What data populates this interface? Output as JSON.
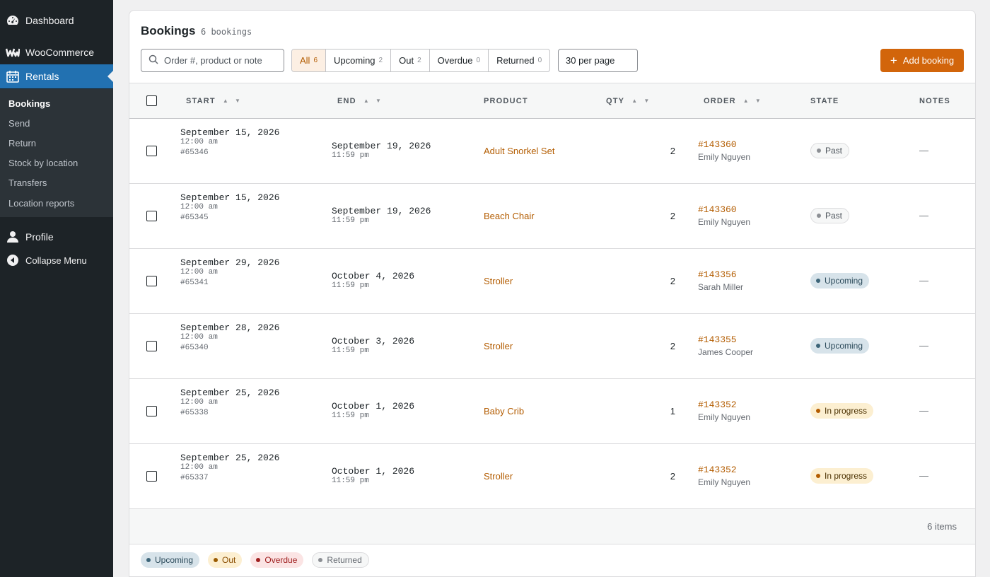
{
  "sidebar": {
    "dashboard": "Dashboard",
    "woocommerce": "WooCommerce",
    "rentals": "Rentals",
    "submenu": [
      "Bookings",
      "Send",
      "Return",
      "Stock by location",
      "Transfers",
      "Location reports"
    ],
    "profile": "Profile",
    "collapse": "Collapse Menu"
  },
  "page": {
    "title": "Bookings",
    "count": "6 bookings",
    "search_placeholder": "Order #, product or note",
    "filters": [
      {
        "label": "All",
        "count": "6"
      },
      {
        "label": "Upcoming",
        "count": "2"
      },
      {
        "label": "Out",
        "count": "2"
      },
      {
        "label": "Overdue",
        "count": "0"
      },
      {
        "label": "Returned",
        "count": "0"
      }
    ],
    "per_page": "30 per page",
    "add_button": "Add booking"
  },
  "table": {
    "headers": {
      "start": "START",
      "end": "END",
      "product": "PRODUCT",
      "qty": "QTY",
      "order": "ORDER",
      "state": "STATE",
      "notes": "NOTES"
    },
    "rows": [
      {
        "start_date": "September 15, 2026",
        "start_time": "12:00 am",
        "booking_id": "#65346",
        "end_date": "September 19, 2026",
        "end_time": "11:59 pm",
        "product": "Adult Snorkel Set",
        "qty": "2",
        "order": "#143360",
        "customer": "Emily Nguyen",
        "state": "Past",
        "notes": "—"
      },
      {
        "start_date": "September 15, 2026",
        "start_time": "12:00 am",
        "booking_id": "#65345",
        "end_date": "September 19, 2026",
        "end_time": "11:59 pm",
        "product": "Beach Chair",
        "qty": "2",
        "order": "#143360",
        "customer": "Emily Nguyen",
        "state": "Past",
        "notes": "—"
      },
      {
        "start_date": "September 29, 2026",
        "start_time": "12:00 am",
        "booking_id": "#65341",
        "end_date": "October 4, 2026",
        "end_time": "11:59 pm",
        "product": "Stroller",
        "qty": "2",
        "order": "#143356",
        "customer": "Sarah Miller",
        "state": "Upcoming",
        "notes": "—"
      },
      {
        "start_date": "September 28, 2026",
        "start_time": "12:00 am",
        "booking_id": "#65340",
        "end_date": "October 3, 2026",
        "end_time": "11:59 pm",
        "product": "Stroller",
        "qty": "2",
        "order": "#143355",
        "customer": "James Cooper",
        "state": "Upcoming",
        "notes": "—"
      },
      {
        "start_date": "September 25, 2026",
        "start_time": "12:00 am",
        "booking_id": "#65338",
        "end_date": "October 1, 2026",
        "end_time": "11:59 pm",
        "product": "Baby Crib",
        "qty": "1",
        "order": "#143352",
        "customer": "Emily Nguyen",
        "state": "In progress",
        "notes": "—"
      },
      {
        "start_date": "September 25, 2026",
        "start_time": "12:00 am",
        "booking_id": "#65337",
        "end_date": "October 1, 2026",
        "end_time": "11:59 pm",
        "product": "Stroller",
        "qty": "2",
        "order": "#143352",
        "customer": "Emily Nguyen",
        "state": "In progress",
        "notes": "—"
      }
    ],
    "footer_items": "6 items"
  },
  "legend": [
    "Upcoming",
    "Out",
    "Overdue",
    "Returned"
  ],
  "colors": {
    "accent": "#d2650b",
    "link": "#b35c00",
    "sidebar_bg": "#1d2327",
    "sidebar_current": "#2271b1",
    "past_bg": "#f6f7f7",
    "past_dot": "#8c8f94",
    "past_text": "#50575e",
    "upcoming_bg": "#d7e3ea",
    "upcoming_dot": "#3c6478",
    "upcoming_text": "#2b4a5a",
    "inprogress_bg": "#fcefd1",
    "inprogress_dot": "#b35c00",
    "inprogress_text": "#4a3000",
    "out_bg": "#fcefd1",
    "out_dot": "#9a5b00",
    "out_text": "#8a4d00",
    "overdue_bg": "#fbe4e4",
    "overdue_dot": "#a02020",
    "overdue_text": "#a02020",
    "returned_bg": "#f6f7f7",
    "returned_dot": "#8c8f94",
    "returned_text": "#646970"
  }
}
